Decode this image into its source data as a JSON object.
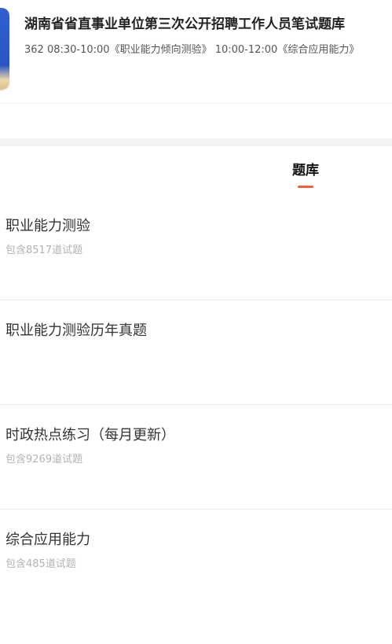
{
  "header": {
    "title": "湖南省省直事业单位第三次公开招聘工作人员笔试题库",
    "subtitle": "362 08:30-10:00《职业能力倾向测验》 10:00-12:00《综合应用能力》"
  },
  "tabs": [
    {
      "label": "题库",
      "active": true
    }
  ],
  "colors": {
    "accent": "#e8643c",
    "title_text": "#333333",
    "muted_text": "#b3b3b3"
  },
  "question_banks": [
    {
      "title": "职业能力测验",
      "count_text": "包含8517道试题"
    },
    {
      "title": "职业能力测验历年真题",
      "count_text": ""
    },
    {
      "title": "时政热点练习（每月更新）",
      "count_text": "包含9269道试题"
    },
    {
      "title": "综合应用能力",
      "count_text": "包含485道试题"
    }
  ]
}
